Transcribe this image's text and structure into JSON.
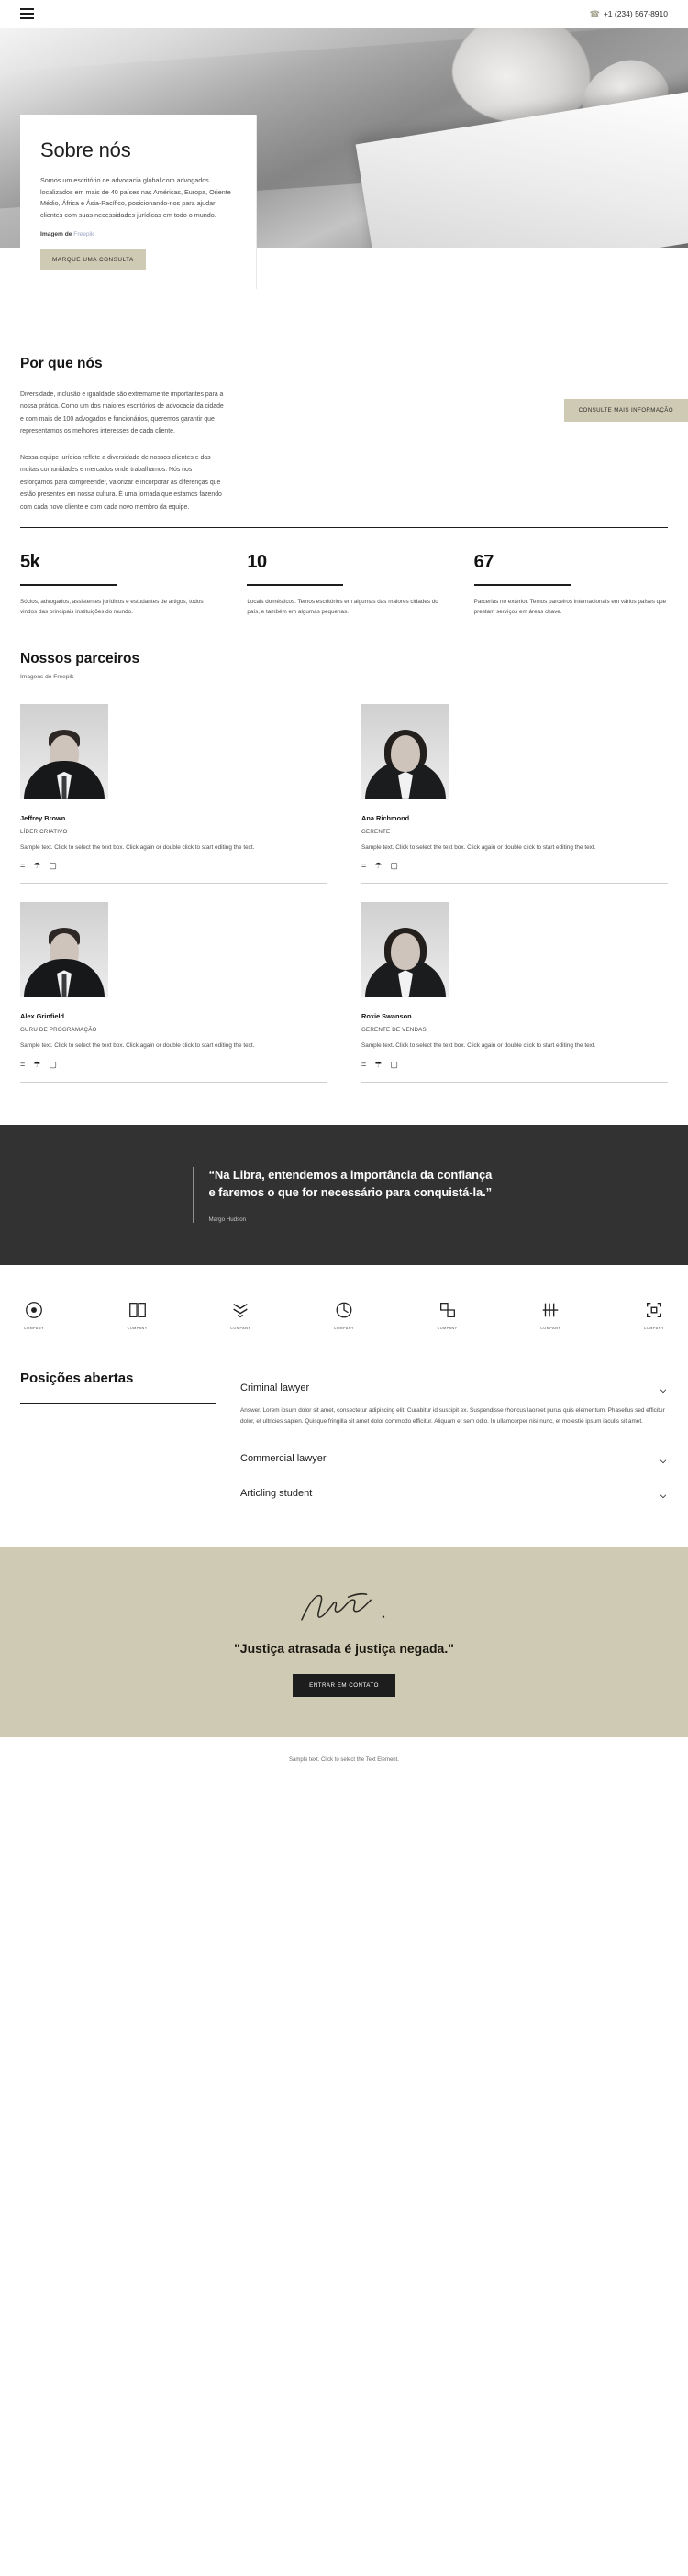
{
  "header": {
    "menu_icon": "hamburger-menu-icon",
    "phone_icon": "phone-icon",
    "phone": "+1 (234) 567-8910"
  },
  "about": {
    "title": "Sobre nós",
    "body": "Somos um escritório de advocacia global com advogados localizados em mais de 40 países nas Américas, Europa, Oriente Médio, África e Ásia-Pacífico, posicionando-nos para ajudar clientes com suas necessidades jurídicas em todo o mundo.",
    "credit_label": "Imagem de",
    "credit_link": "Freepik",
    "cta": "MARQUE UMA CONSULTA"
  },
  "why": {
    "title": "Por que nós",
    "paragraph1": "Diversidade, inclusão e igualdade são extremamente importantes para a nossa prática. Como um dos maiores escritórios de advocacia da cidade e com mais de 100 advogados e funcionários, queremos garantir que representamos os melhores interesses de cada cliente.",
    "paragraph2": "Nossa equipe jurídica reflete a diversidade de nossos clientes e das muitas comunidades e mercados onde trabalhamos. Nós nos esforçamos para compreender, valorizar e incorporar as diferenças que estão presentes em nossa cultura. É uma jornada que estamos fazendo com cada novo cliente e com cada novo membro da equipe.",
    "cta": "CONSULTE MAIS INFORMAÇÃO"
  },
  "stats": [
    {
      "number": "5k",
      "text": "Sócios, advogados, assistentes jurídicos e estudantes de artigos, todos vindos das principais instituições do mundo."
    },
    {
      "number": "10",
      "text": "Locais domésticos. Temos escritórios em algumas das maiores cidades do país, e também em algumas pequenas."
    },
    {
      "number": "67",
      "text": "Parcerias no exterior. Temos parceiros internacionais em vários países que prestam serviços em áreas chave."
    }
  ],
  "partners": {
    "title": "Nossos parceiros",
    "subtitle": "Imagens de Freepik",
    "members": [
      {
        "name": "Jeffrey Brown",
        "role": "LÍDER CRIATIVO",
        "desc": "Sample text. Click to select the text box. Click again or double click to start editing the text."
      },
      {
        "name": "Ana Richmond",
        "role": "GERENTE",
        "desc": "Sample text. Click to select the text box. Click again or double click to start editing the text."
      },
      {
        "name": "Alex Grinfield",
        "role": "GURU DE PROGRAMAÇÃO",
        "desc": "Sample text. Click to select the text box. Click again or double click to start editing the text."
      },
      {
        "name": "Roxie Swanson",
        "role": "GERENTE DE VENDAS",
        "desc": "Sample text. Click to select the text box. Click again or double click to start editing the text."
      }
    ],
    "social_icons": [
      "facebook-icon",
      "twitter-icon",
      "instagram-icon"
    ]
  },
  "quote": {
    "text": "“Na Libra, entendemos a importância da confiança e faremos o que for necessário para conquistá-la.”",
    "author": "Margo Hudson"
  },
  "logos": [
    {
      "name": "COMPANY",
      "mark": "circle-logo-icon"
    },
    {
      "name": "COMPANY",
      "mark": "book-logo-icon"
    },
    {
      "name": "COMPANY",
      "mark": "chevrons-logo-icon"
    },
    {
      "name": "COMPANY",
      "mark": "ring-logo-icon"
    },
    {
      "name": "COMPANY",
      "mark": "squares-logo-icon"
    },
    {
      "name": "COMPANY",
      "mark": "lines-logo-icon"
    },
    {
      "name": "COMPANY",
      "mark": "brackets-logo-icon"
    }
  ],
  "positions": {
    "title": "Posições abertas",
    "items": [
      {
        "title": "Criminal lawyer",
        "expanded": true,
        "body": "Answer. Lorem ipsum dolor sit amet, consectetur adipiscing elit. Curabitur id suscipit ex. Suspendisse rhoncus laoreet purus quis elementum. Phasellus sed efficitur dolor, et ultricies sapien. Quisque fringilla sit amet dolor commodo efficitur. Aliquam et sem odio. In ullamcorper nisi nunc, et molestie ipsum iaculis sit amet."
      },
      {
        "title": "Commercial lawyer",
        "expanded": false,
        "body": ""
      },
      {
        "title": "Articling student",
        "expanded": false,
        "body": ""
      }
    ],
    "chevron_icon": "chevron-down-icon"
  },
  "cta": {
    "signature_icon": "signature-icon",
    "heading": "\"Justiça atrasada é justiça negada.\"",
    "button": "ENTRAR EM CONTATO"
  },
  "footer": {
    "text": "Sample text. Click to select the Text Element."
  },
  "colors": {
    "beige": "#cfcab4",
    "dark": "#323232",
    "ink": "#1d1d1d"
  }
}
